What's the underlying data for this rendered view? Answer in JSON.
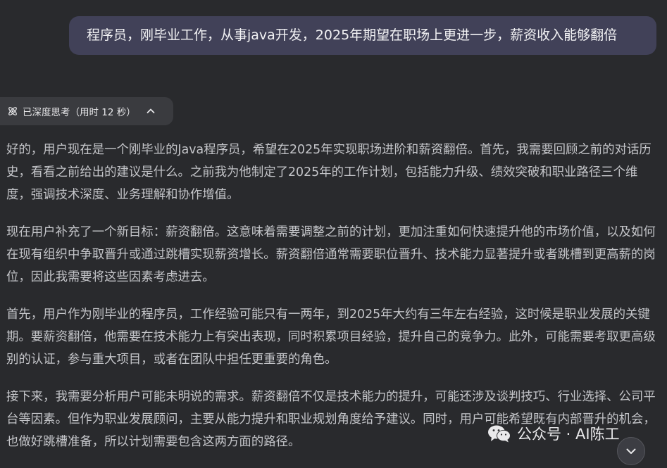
{
  "user_message": "程序员，刚毕业工作，从事java开发，2025年期望在职场上更进一步，薪资收入能够翻倍",
  "thinking_toggle": {
    "icon": "atom-icon",
    "label": "已深度思考（用时 12 秒）",
    "chevron": "chevron-up-icon"
  },
  "reasoning_paragraphs": [
    "好的，用户现在是一个刚毕业的Java程序员，希望在2025年实现职场进阶和薪资翻倍。首先，我需要回顾之前的对话历史，看看之前给出的建议是什么。之前我为他制定了2025年的工作计划，包括能力升级、绩效突破和职业路径三个维度，强调技术深度、业务理解和协作增值。",
    "现在用户补充了一个新目标：薪资翻倍。这意味着需要调整之前的计划，更加注重如何快速提升他的市场价值，以及如何在现有组织中争取晋升或通过跳槽实现薪资增长。薪资翻倍通常需要职位晋升、技术能力显著提升或者跳槽到更高薪的岗位，因此我需要将这些因素考虑进去。",
    "首先，用户作为刚毕业的程序员，工作经验可能只有一两年，到2025年大约有三年左右经验，这时候是职业发展的关键期。要薪资翻倍，他需要在技术能力上有突出表现，同时积累项目经验，提升自己的竞争力。此外，可能需要考取更高级别的认证，参与重大项目，或者在团队中担任更重要的角色。",
    "接下来，我需要分析用户可能未明说的需求。薪资翻倍不仅是技术能力的提升，可能还涉及谈判技巧、行业选择、公司平台等因素。但作为职业发展顾问，主要从能力提升和职业规划角度给予建议。同时，用户可能希望既有内部晋升的机会，也做好跳槽准备，所以计划需要包含这两方面的路径。"
  ],
  "watermark": {
    "icon": "wechat-icon",
    "text": "公众号 · AI陈工"
  },
  "scroll_button": {
    "icon": "chevron-down-icon"
  }
}
